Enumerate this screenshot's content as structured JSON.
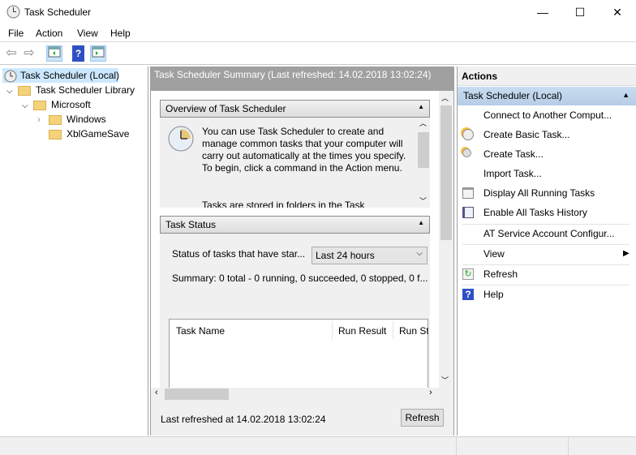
{
  "window": {
    "title": "Task Scheduler",
    "minimize": "—",
    "maximize": "☐",
    "close": "✕"
  },
  "menu": [
    "File",
    "Action",
    "View",
    "Help"
  ],
  "tree": {
    "root": "Task Scheduler (Local)",
    "library": "Task Scheduler Library",
    "microsoft": "Microsoft",
    "windows": "Windows",
    "xbl": "XblGameSave"
  },
  "summary": {
    "header": "Task Scheduler Summary (Last refreshed: 14.02.2018 13:02:24)",
    "overview_title": "Overview of Task Scheduler",
    "overview_text": "You can use Task Scheduler to create and manage common tasks that your computer will carry out automatically at the times you specify. To begin, click a command in the Action menu.",
    "overview_text2": "Tasks are stored in folders in the Task",
    "status_title": "Task Status",
    "status_label": "Status of tasks that have star...",
    "status_select": "Last 24 hours",
    "summary_line": "Summary: 0 total - 0 running, 0 succeeded, 0 stopped, 0 f...",
    "columns": [
      "Task Name",
      "Run Result",
      "Run St"
    ],
    "last_refreshed": "Last refreshed at 14.02.2018 13:02:24",
    "refresh": "Refresh"
  },
  "actions": {
    "header": "Actions",
    "group": "Task Scheduler (Local)",
    "items": [
      "Connect to Another Comput...",
      "Create Basic Task...",
      "Create Task...",
      "Import Task...",
      "Display All Running Tasks",
      "Enable All Tasks History",
      "AT Service Account Configur...",
      "View",
      "Refresh",
      "Help"
    ]
  },
  "colors": {
    "selection": "#cce8ff",
    "actions_group": "#c4d8ee",
    "header_gray": "#a0a0a0"
  }
}
